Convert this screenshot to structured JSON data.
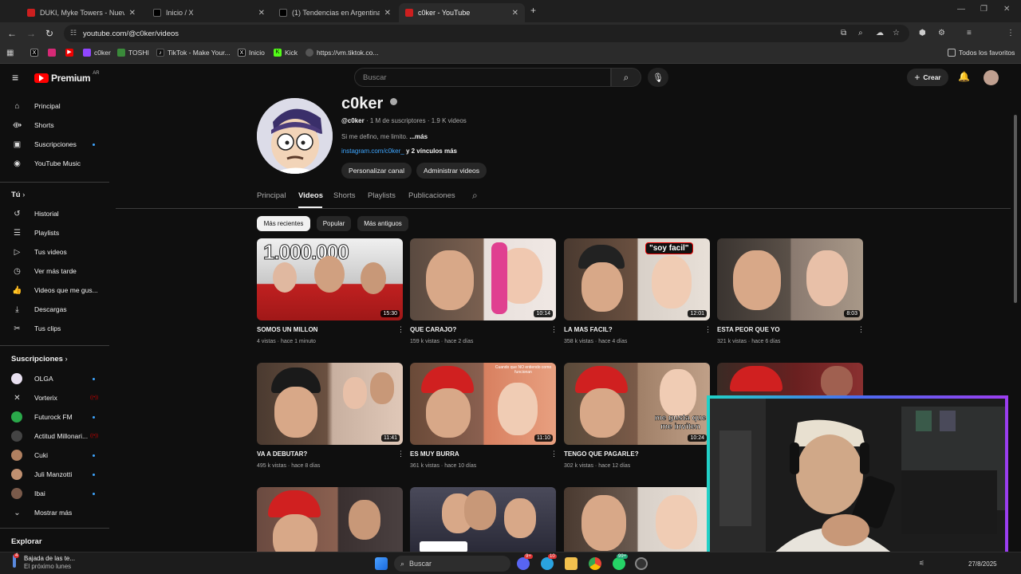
{
  "browser": {
    "tabs": [
      {
        "title": "DUKI, Myke Towers - Nueva Era",
        "active": false,
        "color": "#cc1f1f"
      },
      {
        "title": "Inicio / X",
        "active": false,
        "color": "#000000"
      },
      {
        "title": "(1) Tendencias en Argentina en",
        "active": false,
        "color": "#000000"
      },
      {
        "title": "c0ker - YouTube",
        "active": true,
        "color": "#cc1f1f"
      }
    ],
    "url": "youtube.com/@c0ker/videos",
    "bookmarks": [
      {
        "label": "",
        "icon": "x-icon"
      },
      {
        "label": "",
        "icon": "instagram-icon"
      },
      {
        "label": "",
        "icon": "youtube-icon"
      },
      {
        "label": "c0ker",
        "icon": "twitch-icon"
      },
      {
        "label": "TOSHI",
        "icon": "toshi-icon"
      },
      {
        "label": "TikTok - Make Your...",
        "icon": "tiktok-icon"
      },
      {
        "label": "Inicio",
        "icon": "x-icon"
      },
      {
        "label": "Kick",
        "icon": "kick-icon"
      },
      {
        "label": "https://vm.tiktok.co...",
        "icon": "globe-icon"
      }
    ],
    "all_favorites": "Todos los favoritos"
  },
  "header": {
    "logo_text": "Premium",
    "logo_region": "AR",
    "search_placeholder": "Buscar",
    "create_label": "Crear"
  },
  "sidebar": {
    "main": [
      {
        "label": "Principal",
        "icon": "home-icon"
      },
      {
        "label": "Shorts",
        "icon": "shorts-icon"
      },
      {
        "label": "Suscripciones",
        "icon": "subscriptions-icon"
      },
      {
        "label": "YouTube Music",
        "icon": "music-icon"
      }
    ],
    "you_title": "Tú",
    "you": [
      {
        "label": "Historial",
        "icon": "history-icon"
      },
      {
        "label": "Playlists",
        "icon": "playlists-icon"
      },
      {
        "label": "Tus videos",
        "icon": "your-videos-icon"
      },
      {
        "label": "Ver más tarde",
        "icon": "watch-later-icon"
      },
      {
        "label": "Videos que me gus...",
        "icon": "liked-icon"
      },
      {
        "label": "Descargas",
        "icon": "download-icon"
      },
      {
        "label": "Tus clips",
        "icon": "clips-icon"
      }
    ],
    "subs_title": "Suscripciones",
    "subs": [
      {
        "label": "OLGA",
        "color": "#e8e0f0"
      },
      {
        "label": "Vorterix",
        "color": "#222222"
      },
      {
        "label": "Futurock FM",
        "color": "#2aa84a"
      },
      {
        "label": "Actitud Millonari...",
        "color": "#444444"
      },
      {
        "label": "Cuki",
        "color": "#b08060"
      },
      {
        "label": "Juli Manzotti",
        "color": "#c09070"
      },
      {
        "label": "Ibai",
        "color": "#7a5a4a"
      }
    ],
    "show_more": "Mostrar más",
    "explore_title": "Explorar"
  },
  "channel": {
    "name": "c0ker",
    "handle": "@c0ker",
    "subscribers": "1 M de suscriptores",
    "video_count": "1.9 K videos",
    "description": "Si me defino, me limito.",
    "more": "...más",
    "link": "instagram.com/c0ker_",
    "more_links": "y 2 vínculos más",
    "customize_label": "Personalizar canal",
    "manage_label": "Administrar videos",
    "tabs": [
      "Principal",
      "Videos",
      "Shorts",
      "Playlists",
      "Publicaciones"
    ],
    "selected_tab": "Videos",
    "chips": [
      "Más recientes",
      "Popular",
      "Más antiguos"
    ]
  },
  "videos": [
    {
      "title": "SOMOS UN MILLON",
      "views": "4 vistas",
      "age": "hace 1 minuto",
      "duration": "15:30",
      "bg": "#d8d8d8"
    },
    {
      "title": "QUE CARAJO?",
      "views": "159 k vistas",
      "age": "hace 2 días",
      "duration": "10:14",
      "bg": "#8a6a5a"
    },
    {
      "title": "LA MAS FACIL?",
      "views": "358 k vistas",
      "age": "hace 4 días",
      "duration": "12:01",
      "bg": "#6a5040"
    },
    {
      "title": "ESTA PEOR QUE YO",
      "views": "321 k vistas",
      "age": "hace 6 días",
      "duration": "8:03",
      "bg": "#5a5048"
    },
    {
      "title": "VA A DEBUTAR?",
      "views": "495 k vistas",
      "age": "hace 8 días",
      "duration": "11:41",
      "bg": "#7a6050"
    },
    {
      "title": "ES MUY BURRA",
      "views": "361 k vistas",
      "age": "hace 10 días",
      "duration": "11:10",
      "bg": "#b06040"
    },
    {
      "title": "TENGO QUE PAGARLE?",
      "views": "302 k vistas",
      "age": "hace 12 días",
      "duration": "10:24",
      "bg": "#7a5a48"
    },
    {
      "title": "",
      "views": "",
      "age": "",
      "duration": "",
      "bg": "#6a2020"
    },
    {
      "title": "",
      "views": "",
      "age": "",
      "duration": "",
      "bg": "#6a4a40"
    },
    {
      "title": "",
      "views": "",
      "age": "",
      "duration": "",
      "bg": "#3a3a48"
    },
    {
      "title": "",
      "views": "",
      "age": "",
      "duration": "",
      "bg": "#6a5a50"
    }
  ],
  "thumb_texts": {
    "v1": "1.000.000",
    "v3": "\"soy facil\"",
    "v6": "Cuando que NO entiendo como funcionan",
    "v7": "me gusta que me inviten"
  },
  "taskbar": {
    "notification_title": "Bajada de las te...",
    "notification_sub": "El próximo lunes",
    "notification_badge": "4",
    "search_label": "Buscar",
    "date": "27/8/2025",
    "badges": [
      "9+",
      "10",
      "99+"
    ]
  },
  "colors": {
    "accent_red": "#ff0000",
    "link_blue": "#3ea6ff",
    "bg": "#0f0f0f"
  }
}
